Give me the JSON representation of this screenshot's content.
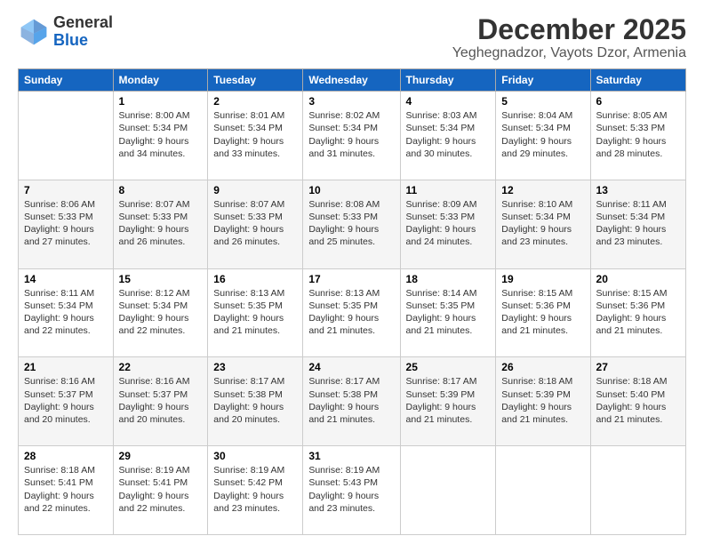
{
  "logo": {
    "general": "General",
    "blue": "Blue"
  },
  "header": {
    "month": "December 2025",
    "location": "Yeghegnadzor, Vayots Dzor, Armenia"
  },
  "weekdays": [
    "Sunday",
    "Monday",
    "Tuesday",
    "Wednesday",
    "Thursday",
    "Friday",
    "Saturday"
  ],
  "weeks": [
    [
      {
        "day": "",
        "sunrise": "",
        "sunset": "",
        "daylight": ""
      },
      {
        "day": "1",
        "sunrise": "Sunrise: 8:00 AM",
        "sunset": "Sunset: 5:34 PM",
        "daylight": "Daylight: 9 hours and 34 minutes."
      },
      {
        "day": "2",
        "sunrise": "Sunrise: 8:01 AM",
        "sunset": "Sunset: 5:34 PM",
        "daylight": "Daylight: 9 hours and 33 minutes."
      },
      {
        "day": "3",
        "sunrise": "Sunrise: 8:02 AM",
        "sunset": "Sunset: 5:34 PM",
        "daylight": "Daylight: 9 hours and 31 minutes."
      },
      {
        "day": "4",
        "sunrise": "Sunrise: 8:03 AM",
        "sunset": "Sunset: 5:34 PM",
        "daylight": "Daylight: 9 hours and 30 minutes."
      },
      {
        "day": "5",
        "sunrise": "Sunrise: 8:04 AM",
        "sunset": "Sunset: 5:34 PM",
        "daylight": "Daylight: 9 hours and 29 minutes."
      },
      {
        "day": "6",
        "sunrise": "Sunrise: 8:05 AM",
        "sunset": "Sunset: 5:33 PM",
        "daylight": "Daylight: 9 hours and 28 minutes."
      }
    ],
    [
      {
        "day": "7",
        "sunrise": "Sunrise: 8:06 AM",
        "sunset": "Sunset: 5:33 PM",
        "daylight": "Daylight: 9 hours and 27 minutes."
      },
      {
        "day": "8",
        "sunrise": "Sunrise: 8:07 AM",
        "sunset": "Sunset: 5:33 PM",
        "daylight": "Daylight: 9 hours and 26 minutes."
      },
      {
        "day": "9",
        "sunrise": "Sunrise: 8:07 AM",
        "sunset": "Sunset: 5:33 PM",
        "daylight": "Daylight: 9 hours and 26 minutes."
      },
      {
        "day": "10",
        "sunrise": "Sunrise: 8:08 AM",
        "sunset": "Sunset: 5:33 PM",
        "daylight": "Daylight: 9 hours and 25 minutes."
      },
      {
        "day": "11",
        "sunrise": "Sunrise: 8:09 AM",
        "sunset": "Sunset: 5:33 PM",
        "daylight": "Daylight: 9 hours and 24 minutes."
      },
      {
        "day": "12",
        "sunrise": "Sunrise: 8:10 AM",
        "sunset": "Sunset: 5:34 PM",
        "daylight": "Daylight: 9 hours and 23 minutes."
      },
      {
        "day": "13",
        "sunrise": "Sunrise: 8:11 AM",
        "sunset": "Sunset: 5:34 PM",
        "daylight": "Daylight: 9 hours and 23 minutes."
      }
    ],
    [
      {
        "day": "14",
        "sunrise": "Sunrise: 8:11 AM",
        "sunset": "Sunset: 5:34 PM",
        "daylight": "Daylight: 9 hours and 22 minutes."
      },
      {
        "day": "15",
        "sunrise": "Sunrise: 8:12 AM",
        "sunset": "Sunset: 5:34 PM",
        "daylight": "Daylight: 9 hours and 22 minutes."
      },
      {
        "day": "16",
        "sunrise": "Sunrise: 8:13 AM",
        "sunset": "Sunset: 5:35 PM",
        "daylight": "Daylight: 9 hours and 21 minutes."
      },
      {
        "day": "17",
        "sunrise": "Sunrise: 8:13 AM",
        "sunset": "Sunset: 5:35 PM",
        "daylight": "Daylight: 9 hours and 21 minutes."
      },
      {
        "day": "18",
        "sunrise": "Sunrise: 8:14 AM",
        "sunset": "Sunset: 5:35 PM",
        "daylight": "Daylight: 9 hours and 21 minutes."
      },
      {
        "day": "19",
        "sunrise": "Sunrise: 8:15 AM",
        "sunset": "Sunset: 5:36 PM",
        "daylight": "Daylight: 9 hours and 21 minutes."
      },
      {
        "day": "20",
        "sunrise": "Sunrise: 8:15 AM",
        "sunset": "Sunset: 5:36 PM",
        "daylight": "Daylight: 9 hours and 21 minutes."
      }
    ],
    [
      {
        "day": "21",
        "sunrise": "Sunrise: 8:16 AM",
        "sunset": "Sunset: 5:37 PM",
        "daylight": "Daylight: 9 hours and 20 minutes."
      },
      {
        "day": "22",
        "sunrise": "Sunrise: 8:16 AM",
        "sunset": "Sunset: 5:37 PM",
        "daylight": "Daylight: 9 hours and 20 minutes."
      },
      {
        "day": "23",
        "sunrise": "Sunrise: 8:17 AM",
        "sunset": "Sunset: 5:38 PM",
        "daylight": "Daylight: 9 hours and 20 minutes."
      },
      {
        "day": "24",
        "sunrise": "Sunrise: 8:17 AM",
        "sunset": "Sunset: 5:38 PM",
        "daylight": "Daylight: 9 hours and 21 minutes."
      },
      {
        "day": "25",
        "sunrise": "Sunrise: 8:17 AM",
        "sunset": "Sunset: 5:39 PM",
        "daylight": "Daylight: 9 hours and 21 minutes."
      },
      {
        "day": "26",
        "sunrise": "Sunrise: 8:18 AM",
        "sunset": "Sunset: 5:39 PM",
        "daylight": "Daylight: 9 hours and 21 minutes."
      },
      {
        "day": "27",
        "sunrise": "Sunrise: 8:18 AM",
        "sunset": "Sunset: 5:40 PM",
        "daylight": "Daylight: 9 hours and 21 minutes."
      }
    ],
    [
      {
        "day": "28",
        "sunrise": "Sunrise: 8:18 AM",
        "sunset": "Sunset: 5:41 PM",
        "daylight": "Daylight: 9 hours and 22 minutes."
      },
      {
        "day": "29",
        "sunrise": "Sunrise: 8:19 AM",
        "sunset": "Sunset: 5:41 PM",
        "daylight": "Daylight: 9 hours and 22 minutes."
      },
      {
        "day": "30",
        "sunrise": "Sunrise: 8:19 AM",
        "sunset": "Sunset: 5:42 PM",
        "daylight": "Daylight: 9 hours and 23 minutes."
      },
      {
        "day": "31",
        "sunrise": "Sunrise: 8:19 AM",
        "sunset": "Sunset: 5:43 PM",
        "daylight": "Daylight: 9 hours and 23 minutes."
      },
      {
        "day": "",
        "sunrise": "",
        "sunset": "",
        "daylight": ""
      },
      {
        "day": "",
        "sunrise": "",
        "sunset": "",
        "daylight": ""
      },
      {
        "day": "",
        "sunrise": "",
        "sunset": "",
        "daylight": ""
      }
    ]
  ]
}
